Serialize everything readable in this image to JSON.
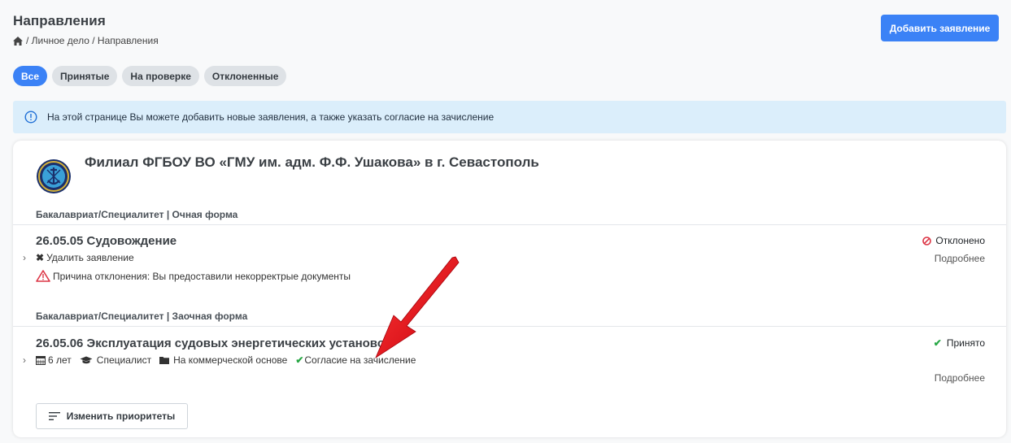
{
  "header": {
    "title": "Направления",
    "breadcrumb": "/ Личное дело  / Направления",
    "add_button": "Добавить заявление"
  },
  "tabs": [
    {
      "label": "Все",
      "active": true
    },
    {
      "label": "Принятые",
      "active": false
    },
    {
      "label": "На проверке",
      "active": false
    },
    {
      "label": "Отклоненные",
      "active": false
    }
  ],
  "info": {
    "text": "На этой странице Вы можете добавить новые заявления, а также указать согласие на зачисление"
  },
  "institution": {
    "name": "Филиал ФГБОУ ВО «ГМУ им. адм. Ф.Ф. Ушакова» в г. Севастополь"
  },
  "groups": [
    {
      "label": "Бакалавриат/Специалитет | Очная форма",
      "program": {
        "title": "26.05.05 Судовождение",
        "delete_label": "Удалить заявление",
        "reject_reason": "Причина отклонения: Вы предоставили некорректрые документы",
        "status": "Отклонено",
        "more": "Подробнее"
      }
    },
    {
      "label": "Бакалавриат/Специалитет | Заочная форма",
      "program": {
        "title": "26.05.06 Эксплуатация судовых энергетических установок",
        "duration": "6 лет",
        "level": "Специалист",
        "basis": "На коммерческой основе",
        "consent": "Согласие на зачисление",
        "status": "Принято",
        "more": "Подробнее"
      }
    }
  ],
  "priorities_button": "Изменить приоритеты",
  "colors": {
    "accent": "#3b82f6",
    "rejected": "#dc3545",
    "accepted": "#28a745",
    "annotation_arrow": "#e8141c"
  }
}
